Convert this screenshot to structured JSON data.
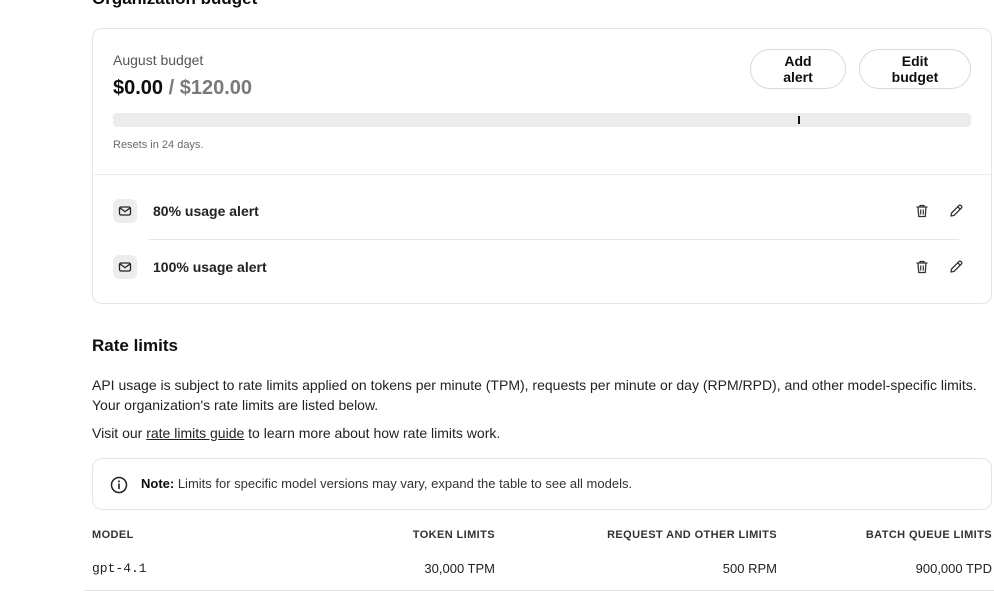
{
  "budget_section": {
    "title": "Organization budget",
    "period_label": "August budget",
    "spent": "$0.00",
    "separator": " / ",
    "limit": "$120.00",
    "spent_fraction": 0.0,
    "alert_marker_fraction": 0.8,
    "add_alert_label": "Add alert",
    "edit_budget_label": "Edit budget",
    "resets_text": "Resets in 24 days.",
    "alerts": [
      {
        "label": "80% usage alert",
        "icon": "mail-icon"
      },
      {
        "label": "100% usage alert",
        "icon": "mail-icon"
      }
    ]
  },
  "rate_limits": {
    "title": "Rate limits",
    "description": "API usage is subject to rate limits applied on tokens per minute (TPM), requests per minute or day (RPM/RPD), and other model-specific limits. Your organization's rate limits are listed below.",
    "visit_prefix": "Visit our ",
    "visit_link": "rate limits guide",
    "visit_suffix": " to learn more about how rate limits work.",
    "note_label": "Note:",
    "note_text": " Limits for specific model versions may vary, expand the table to see all models.",
    "table": {
      "headers": [
        "MODEL",
        "TOKEN LIMITS",
        "REQUEST AND OTHER LIMITS",
        "BATCH QUEUE LIMITS"
      ],
      "rows": [
        {
          "model": "gpt-4.1",
          "token": "30,000 TPM",
          "request": "500 RPM",
          "batch": "900,000 TPD"
        }
      ]
    }
  },
  "colors": {
    "progress_fill": "#10a37f",
    "track": "#ececec",
    "border": "#e5e5e5"
  }
}
